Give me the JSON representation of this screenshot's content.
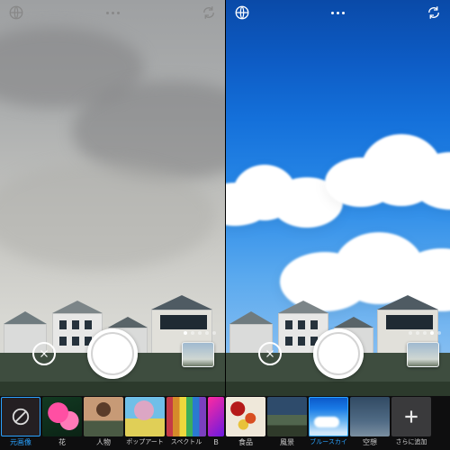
{
  "topbar": {
    "globe_icon": "globe-icon",
    "more_icon": "more-icon",
    "refresh_icon": "refresh-icon"
  },
  "camera": {
    "close_icon": "close-icon",
    "shutter": "shutter-button",
    "last_photo_thumb": "last-photo-thumbnail",
    "pager_total": 5,
    "pager_active_index_left": 0,
    "pager_active_index_right": 3
  },
  "filters": {
    "none_label": "元画像",
    "add_label": "さらに追加",
    "items": [
      {
        "id": "hana",
        "label": "花"
      },
      {
        "id": "jinbutsu",
        "label": "人物"
      },
      {
        "id": "popart",
        "label": "ポップアート"
      },
      {
        "id": "spectre",
        "label": "スペクトル"
      },
      {
        "id": "b",
        "label": "B"
      },
      {
        "id": "food",
        "label": "食品"
      },
      {
        "id": "fuukei",
        "label": "風景"
      },
      {
        "id": "bluesky",
        "label": "ブルースカイ"
      },
      {
        "id": "kuusou",
        "label": "空想"
      }
    ],
    "selected_left": "none",
    "selected_right": "bluesky"
  }
}
